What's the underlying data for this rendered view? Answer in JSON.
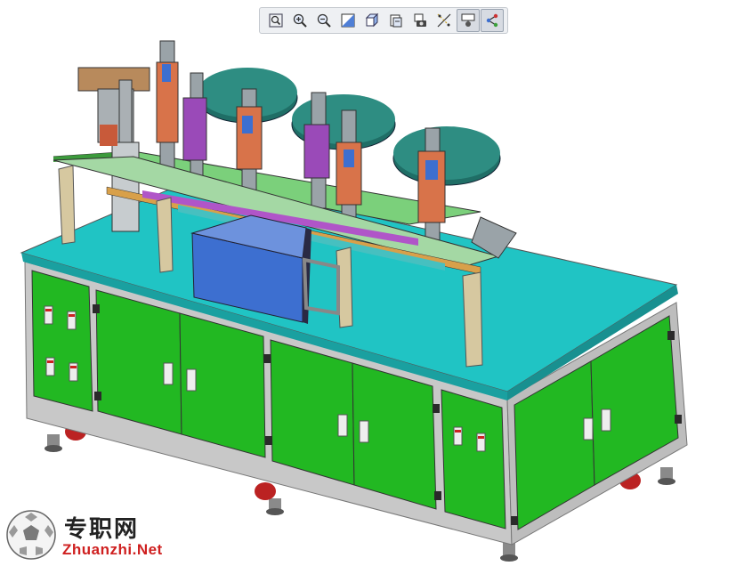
{
  "toolbar": {
    "buttons": [
      {
        "name": "zoom-fit-icon",
        "active": false
      },
      {
        "name": "zoom-in-icon",
        "active": false
      },
      {
        "name": "zoom-out-icon",
        "active": false
      },
      {
        "name": "shaded-view-icon",
        "active": false
      },
      {
        "name": "cube-view-icon",
        "active": false
      },
      {
        "name": "section-view-icon",
        "active": false
      },
      {
        "name": "camera-icon",
        "active": false
      },
      {
        "name": "explode-icon",
        "active": false
      },
      {
        "name": "display-style-icon",
        "active": true
      },
      {
        "name": "tree-icon",
        "active": true
      }
    ]
  },
  "colors": {
    "tabletop": "#20c4c4",
    "cabinet": "#22b822",
    "frame": "#c8c8c8",
    "accent_blue": "#3d6fd0",
    "accent_orange": "#d8734a",
    "accent_purple": "#9a4ab8",
    "dark_teal": "#1f6e66"
  },
  "watermark": {
    "cn": "专职网",
    "en": "Zhuanzhi.Net"
  }
}
